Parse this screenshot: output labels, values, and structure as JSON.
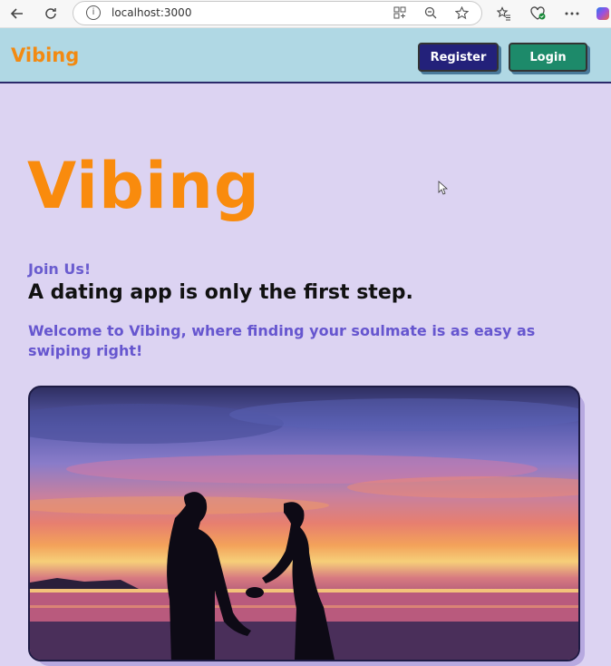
{
  "browser": {
    "url": "localhost:3000",
    "icons": [
      "back-icon",
      "refresh-icon",
      "info-icon",
      "apps-icon",
      "zoom-icon",
      "favorite-star-icon",
      "favorites-list-icon",
      "health-heart-icon",
      "more-icon",
      "copilot-icon"
    ]
  },
  "navbar": {
    "brand": "Vibing",
    "register_label": "Register",
    "login_label": "Login"
  },
  "main": {
    "title": "Vibing",
    "join": "Join Us!",
    "tagline": "A dating app is only the first step.",
    "welcome": "Welcome to Vibing, where finding your soulmate is as easy as swiping right!"
  },
  "colors": {
    "accent_orange": "#f98b0d",
    "navbar_bg": "#b0d8e4",
    "page_bg": "#dcd3f2",
    "register_bg": "#23217a",
    "login_bg": "#1d8a6a",
    "purple_text": "#6656cf"
  }
}
